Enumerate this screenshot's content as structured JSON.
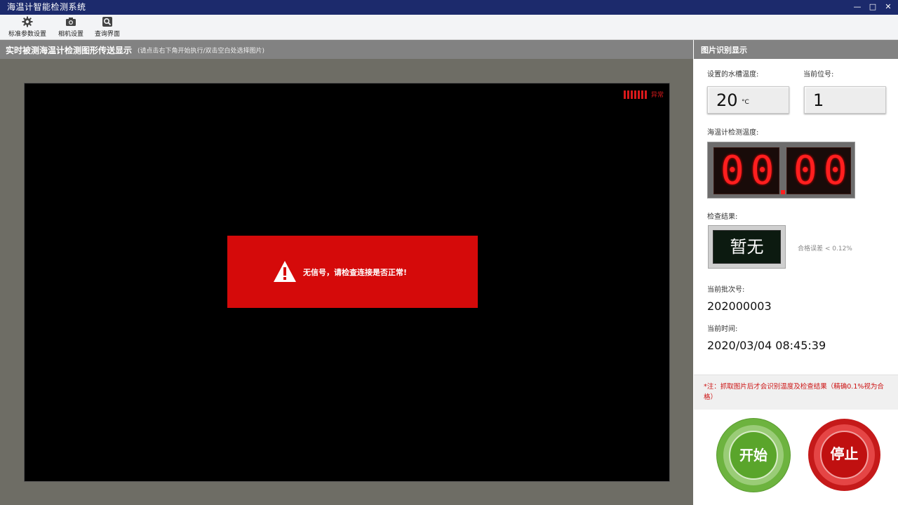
{
  "window": {
    "title": "海温计智能检测系统",
    "controls": [
      "—",
      "□",
      "✕"
    ]
  },
  "toolbar": {
    "items": [
      {
        "label": "标准参数设置",
        "icon": "gear-icon"
      },
      {
        "label": "相机设置",
        "icon": "camera-icon"
      },
      {
        "label": "查询界面",
        "icon": "search-icon"
      }
    ]
  },
  "left_panel": {
    "title": "实时被测海温计检测图形传送显示",
    "hint": "(请点击右下角开始执行/双击空白处选择图片)",
    "signal_status": "异常",
    "alert_message": "无信号，请检查连接是否正常!",
    "colors": {
      "alert": "#d50a0a",
      "signal": "#d8191b"
    }
  },
  "right_panel": {
    "title": "图片识别显示",
    "tank_temp_label": "设置的水槽温度:",
    "tank_temp_value": "20",
    "tank_temp_unit": "°C",
    "position_label": "当前位号:",
    "position_value": "1",
    "detected_temp_label": "海温计检测温度:",
    "detected_temp_int": "00",
    "detected_temp_dec": "00",
    "result_label": "检查结果:",
    "result_value": "暂无",
    "tolerance_text": "合格误差 < 0.12%",
    "batch_label": "当前批次号:",
    "batch_value": "202000003",
    "time_label": "当前时间:",
    "time_value": "2020/03/04 08:45:39",
    "note": "*注：抓取图片后才会识别温度及检查结果（精确0.1%视为合格）",
    "start_label": "开始",
    "stop_label": "停止",
    "colors": {
      "led": "#ff1f1f",
      "start": "#6db33f",
      "stop": "#c51a1a",
      "note": "#cc1111"
    }
  }
}
